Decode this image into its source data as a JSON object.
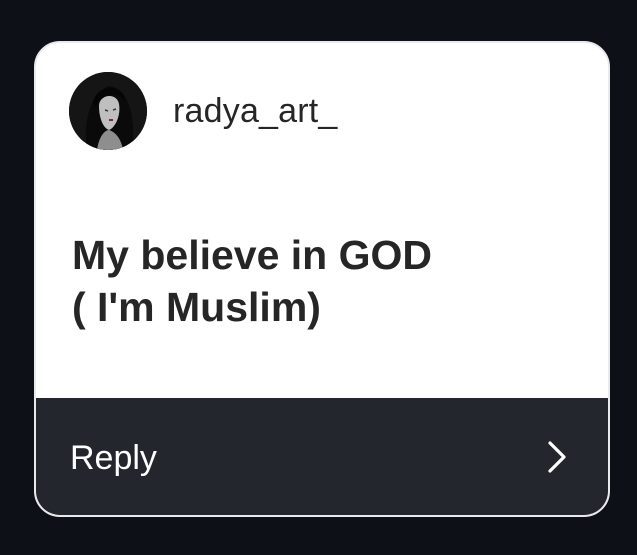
{
  "card": {
    "username": "radya_art_",
    "avatar_icon": "profile-avatar",
    "question_lines": [
      "My believe in GOD",
      "( I'm Muslim)"
    ]
  },
  "reply": {
    "label": "Reply",
    "icon": "chevron-right-icon"
  },
  "colors": {
    "background": "#0d1017",
    "card": "#ffffff",
    "text": "#262626",
    "reply_bar": "#23272d",
    "reply_text": "#ffffff"
  }
}
